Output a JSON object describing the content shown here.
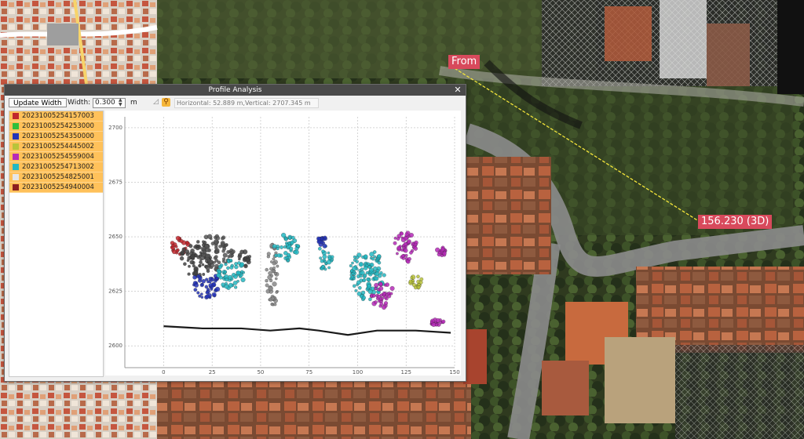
{
  "window": {
    "title": "Profile Analysis",
    "close_icon": "close-icon"
  },
  "toolbar": {
    "update_label": "Update Width",
    "width_label": "Width:",
    "width_value": "0.300",
    "unit": "m",
    "icons": [
      "pencil-icon",
      "magnifier-icon"
    ],
    "readout": "Horizontal: 52.889 m,Vertical: 2707.345 m"
  },
  "layers": [
    {
      "name": "20231005254157003",
      "color": "#c1272d"
    },
    {
      "name": "20231005254253000",
      "color": "#2fbf3a"
    },
    {
      "name": "20231005254350000",
      "color": "#2433b8"
    },
    {
      "name": "20231005254445002",
      "color": "#b9c43a"
    },
    {
      "name": "20231005254559004",
      "color": "#b62ab8"
    },
    {
      "name": "20231005254713002",
      "color": "#25b8c2"
    },
    {
      "name": "20231005254825001",
      "color": "#e6e6e6"
    },
    {
      "name": "20231005254940004",
      "color": "#8c1f1f"
    }
  ],
  "measure": {
    "start_label": "From",
    "distance_label": "156.230 (3D)"
  },
  "chart_data": {
    "type": "scatter",
    "title": "",
    "xlabel": "",
    "ylabel": "",
    "xlim": [
      -20,
      150
    ],
    "ylim": [
      2590,
      2705
    ],
    "x_ticks": [
      0,
      25,
      50,
      75,
      100,
      125,
      150
    ],
    "y_ticks": [
      2625,
      2650,
      2675,
      2700
    ],
    "y_tick_labels": [
      "2600",
      "2625",
      "2650",
      "2675",
      "2700"
    ],
    "grid": true,
    "ground": [
      [
        0,
        2609
      ],
      [
        20,
        2608
      ],
      [
        40,
        2608
      ],
      [
        55,
        2607
      ],
      [
        70,
        2608
      ],
      [
        80,
        2607
      ],
      [
        95,
        2605
      ],
      [
        110,
        2607
      ],
      [
        130,
        2607
      ],
      [
        148,
        2606
      ]
    ],
    "clusters": [
      {
        "x": 8,
        "y": 2645,
        "w": 10,
        "h": 10,
        "color": "#c1272d"
      },
      {
        "x": 17,
        "y": 2640,
        "w": 16,
        "h": 18,
        "color": "#444444"
      },
      {
        "x": 27,
        "y": 2643,
        "w": 18,
        "h": 17,
        "color": "#555555"
      },
      {
        "x": 22,
        "y": 2628,
        "w": 16,
        "h": 12,
        "color": "#2433b8"
      },
      {
        "x": 35,
        "y": 2633,
        "w": 14,
        "h": 15,
        "color": "#25b8c2"
      },
      {
        "x": 42,
        "y": 2640,
        "w": 6,
        "h": 8,
        "color": "#444444"
      },
      {
        "x": 56,
        "y": 2632,
        "w": 6,
        "h": 30,
        "color": "#888888"
      },
      {
        "x": 63,
        "y": 2645,
        "w": 14,
        "h": 12,
        "color": "#25b8c2"
      },
      {
        "x": 83,
        "y": 2640,
        "w": 8,
        "h": 12,
        "color": "#25b8c2"
      },
      {
        "x": 82,
        "y": 2648,
        "w": 5,
        "h": 5,
        "color": "#2433b8"
      },
      {
        "x": 105,
        "y": 2633,
        "w": 18,
        "h": 24,
        "color": "#25b8c2"
      },
      {
        "x": 113,
        "y": 2623,
        "w": 12,
        "h": 12,
        "color": "#b62ab8"
      },
      {
        "x": 124,
        "y": 2645,
        "w": 14,
        "h": 14,
        "color": "#b62ab8"
      },
      {
        "x": 130,
        "y": 2630,
        "w": 6,
        "h": 8,
        "color": "#b9c43a"
      },
      {
        "x": 143,
        "y": 2643,
        "w": 4,
        "h": 5,
        "color": "#b62ab8"
      },
      {
        "x": 141,
        "y": 2611,
        "w": 7,
        "h": 3,
        "color": "#b62ab8"
      }
    ],
    "series_colors": {
      "ground": "#1a1a1a"
    }
  }
}
